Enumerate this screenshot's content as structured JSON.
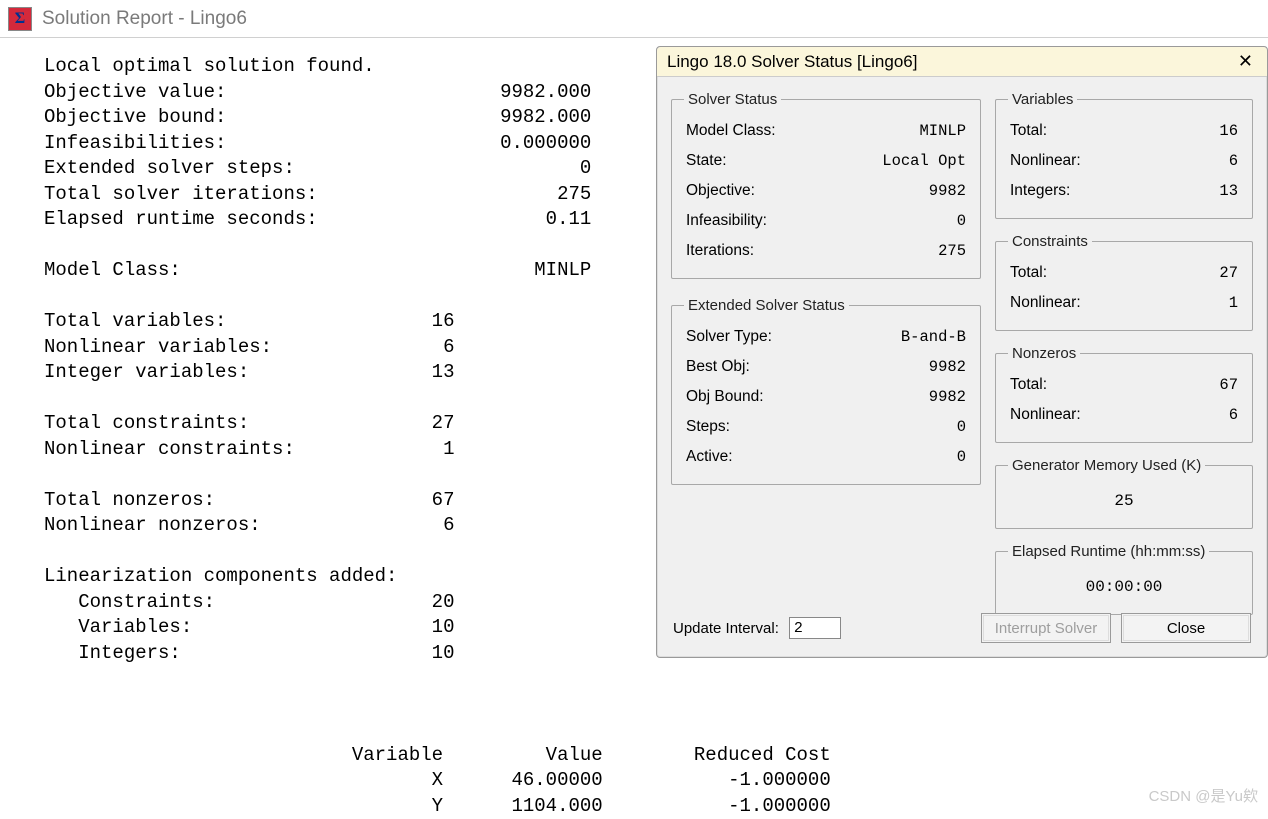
{
  "window": {
    "title": "Solution Report - Lingo6"
  },
  "report": {
    "status_line": "Local optimal solution found.",
    "objective_value_label": "Objective value:",
    "objective_value": "9982.000",
    "objective_bound_label": "Objective bound:",
    "objective_bound": "9982.000",
    "infeasibilities_label": "Infeasibilities:",
    "infeasibilities": "0.000000",
    "ext_steps_label": "Extended solver steps:",
    "ext_steps": "0",
    "iterations_label": "Total solver iterations:",
    "iterations": "275",
    "elapsed_label": "Elapsed runtime seconds:",
    "elapsed": "0.11",
    "model_class_label": "Model Class:",
    "model_class": "MINLP",
    "tot_vars_label": "Total variables:",
    "tot_vars": "16",
    "nonlin_vars_label": "Nonlinear variables:",
    "nonlin_vars": "6",
    "int_vars_label": "Integer variables:",
    "int_vars": "13",
    "tot_cons_label": "Total constraints:",
    "tot_cons": "27",
    "nonlin_cons_label": "Nonlinear constraints:",
    "nonlin_cons": "1",
    "tot_nz_label": "Total nonzeros:",
    "tot_nz": "67",
    "nonlin_nz_label": "Nonlinear nonzeros:",
    "nonlin_nz": "6",
    "lin_label": "Linearization components added:",
    "lin_cons_label": "Constraints:",
    "lin_cons": "20",
    "lin_vars_label": "Variables:",
    "lin_vars": "10",
    "lin_ints_label": "Integers:",
    "lin_ints": "10",
    "col_variable": "Variable",
    "col_value": "Value",
    "col_reduced": "Reduced Cost",
    "rows": [
      {
        "name": "X",
        "value": "46.00000",
        "reduced": "-1.000000"
      },
      {
        "name": "Y",
        "value": "1104.000",
        "reduced": "-1.000000"
      }
    ]
  },
  "dialog": {
    "title": "Lingo 18.0 Solver Status [Lingo6]",
    "solver_status_legend": "Solver Status",
    "model_class_label": "Model Class:",
    "model_class": "MINLP",
    "state_label": "State:",
    "state": "Local Opt",
    "objective_label": "Objective:",
    "objective": "9982",
    "infeas_label": "Infeasibility:",
    "infeas": "0",
    "iter_label": "Iterations:",
    "iter": "275",
    "ext_legend": "Extended Solver Status",
    "solver_type_label": "Solver Type:",
    "solver_type": "B-and-B",
    "best_obj_label": "Best Obj:",
    "best_obj": "9982",
    "obj_bound_label": "Obj Bound:",
    "obj_bound": "9982",
    "steps_label": "Steps:",
    "steps": "0",
    "active_label": "Active:",
    "active": "0",
    "vars_legend": "Variables",
    "vars_total_label": "Total:",
    "vars_total": "16",
    "vars_nonlin_label": "Nonlinear:",
    "vars_nonlin": "6",
    "vars_int_label": "Integers:",
    "vars_int": "13",
    "cons_legend": "Constraints",
    "cons_total_label": "Total:",
    "cons_total": "27",
    "cons_nonlin_label": "Nonlinear:",
    "cons_nonlin": "1",
    "nz_legend": "Nonzeros",
    "nz_total_label": "Total:",
    "nz_total": "67",
    "nz_nonlin_label": "Nonlinear:",
    "nz_nonlin": "6",
    "mem_legend": "Generator Memory Used (K)",
    "mem_value": "25",
    "runtime_legend": "Elapsed Runtime (hh:mm:ss)",
    "runtime_value": "00:00:00",
    "update_label": "Update Interval:",
    "update_value": "2",
    "interrupt_label": "Interrupt Solver",
    "close_label": "Close"
  },
  "watermark": "CSDN @是Yu欸"
}
